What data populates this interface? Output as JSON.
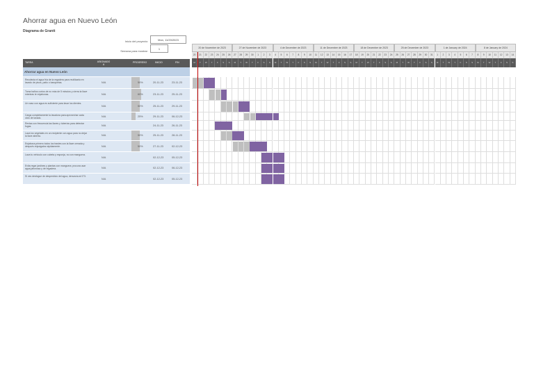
{
  "title": "Ahorrar agua en Nuevo León",
  "subtitle": "Diagrama de Grantt",
  "project_start_label": "Inicio del proyecto:",
  "project_start_value": "Mon, 11/20/2023",
  "week_label": "Semana para mostrar:",
  "week_value": "1",
  "headers": {
    "task": "TAREA",
    "assigned": "ASIGNADO A",
    "progress": "PROGRESO",
    "start": "INICIO",
    "end": "FIN"
  },
  "group": "Ahorrar agua en Nuevo León",
  "weeks": [
    "20 de November de 2023",
    "27 de November de 2023",
    "4 de December de 2023",
    "11 de December de 2023",
    "18 de December de 2023",
    "25 de December de 2023",
    "1 de January de 2024",
    "8 de January de 2024"
  ],
  "day_numbers": [
    "20",
    "21",
    "22",
    "23",
    "24",
    "25",
    "26",
    "27",
    "28",
    "29",
    "30",
    "1",
    "2",
    "3",
    "4",
    "5",
    "6",
    "7",
    "8",
    "9",
    "10",
    "11",
    "12",
    "13",
    "14",
    "15",
    "16",
    "17",
    "18",
    "19",
    "20",
    "21",
    "22",
    "23",
    "24",
    "25",
    "26",
    "27",
    "28",
    "29",
    "30",
    "31",
    "1",
    "2",
    "3",
    "4",
    "5",
    "6",
    "7",
    "8",
    "9",
    "10",
    "11",
    "12",
    "13",
    "14"
  ],
  "day_letters": [
    "M",
    "T",
    "W",
    "T",
    "F",
    "S",
    "S"
  ],
  "colors": {
    "bar": "#8064a2",
    "done": "#bfbfbf",
    "today": "#c00000"
  },
  "today_offset": 1,
  "tasks": [
    {
      "name": "Recolecta el agua fría de la regadera para reutilizarla en lavado de pisos, patio o banquetas.",
      "assigned": "N/A",
      "progress": "50%",
      "p": 50,
      "start": "20-11-23",
      "end": "23-11-23",
      "s": 0,
      "d": 4
    },
    {
      "name": "Toma baños cortos de no más de 5 minutos y cierra la llave mientras te enjabonas.",
      "assigned": "N/A",
      "progress": "60%",
      "p": 60,
      "start": "23-11-23",
      "end": "25-11-23",
      "s": 3,
      "d": 3
    },
    {
      "name": "Un vaso con agua es suficiente para lavar los dientes.",
      "assigned": "N/A",
      "progress": "50%",
      "p": 50,
      "start": "25-11-23",
      "end": "29-11-23",
      "s": 5,
      "d": 5
    },
    {
      "name": "Carga completamente la lavadora para aprovechar cada ciclo de lavado.",
      "assigned": "N/A",
      "progress": "25%",
      "p": 25,
      "start": "29-11-23",
      "end": "06-12-23",
      "s": 9,
      "d": 6
    },
    {
      "name": "Revisa con frecuencia las llaves y tuberías para detectar fugas.",
      "assigned": "N/A",
      "progress": "",
      "p": 0,
      "start": "24-11-23",
      "end": "26-11-23",
      "s": 4,
      "d": 3
    },
    {
      "name": "Lava los vegetales en un recipiente con agua para no dejar la llave abierta.",
      "assigned": "N/A",
      "progress": "50%",
      "p": 50,
      "start": "25-11-23",
      "end": "28-11-23",
      "s": 5,
      "d": 4
    },
    {
      "name": "Enjabona primero todos los trastes con la llave cerrada y después enjuágalos rápidamente.",
      "assigned": "N/A",
      "progress": "50%",
      "p": 50,
      "start": "27-11-23",
      "end": "02-12-23",
      "s": 7,
      "d": 6
    },
    {
      "name": "Lava tu vehículo con cubeta y esponja, no con manguera.",
      "assigned": "N/A",
      "progress": "",
      "p": 0,
      "start": "02-12-23",
      "end": "05-12-23",
      "s": 12,
      "d": 4
    },
    {
      "name": "Evita regar jardines y plantas con manguera; procura usar agua jabonosa y de regadera.",
      "assigned": "N/A",
      "progress": "",
      "p": 0,
      "start": "02-12-23",
      "end": "06-12-23",
      "s": 12,
      "d": 4
    },
    {
      "name": "Si ves desfogue de desperdicio del agua, denuncia al 073.",
      "assigned": "N/A",
      "progress": "",
      "p": 0,
      "start": "02-12-23",
      "end": "05-12-23",
      "s": 12,
      "d": 4
    }
  ]
}
